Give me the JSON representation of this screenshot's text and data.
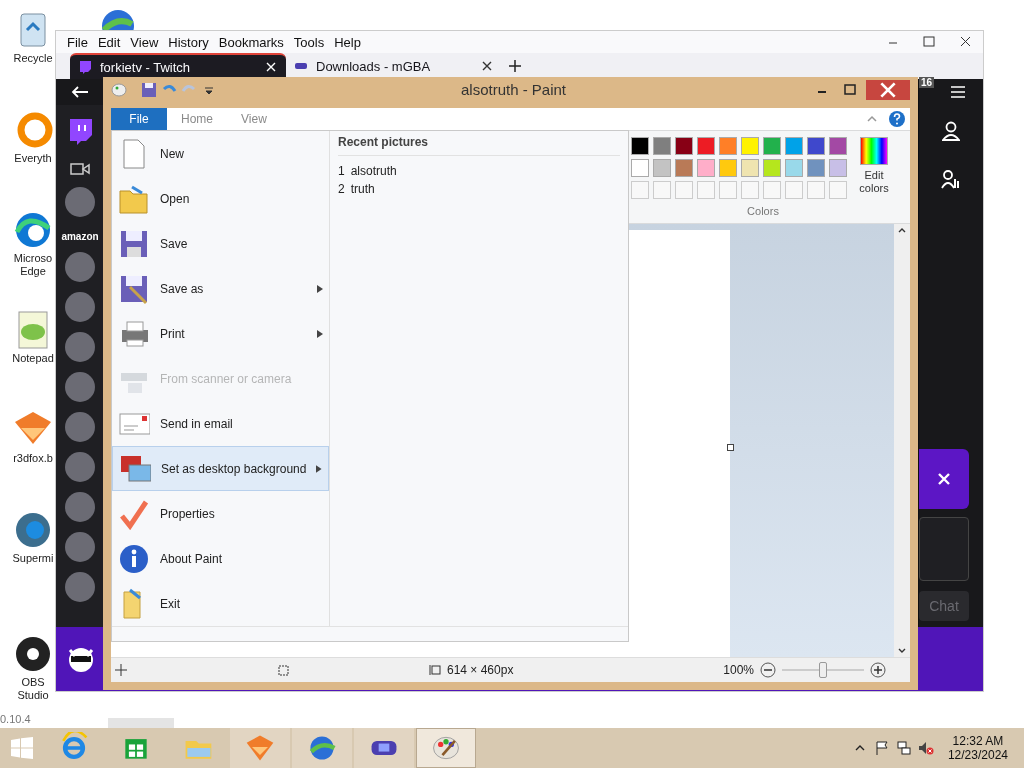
{
  "desktop": {
    "icons": [
      {
        "label": "Recycle"
      },
      {
        "label": "Everyth"
      },
      {
        "label": "Microso Edge"
      },
      {
        "label": "Notepad"
      },
      {
        "label": "r3dfox.b"
      },
      {
        "label": "Supermi"
      },
      {
        "label": "OBS Studio"
      }
    ],
    "version_text": "0.10.4"
  },
  "browser": {
    "menu": [
      "File",
      "Edit",
      "View",
      "History",
      "Bookmarks",
      "Tools",
      "Help"
    ],
    "tabs": [
      {
        "title": "forkietv - Twitch",
        "selected": true
      },
      {
        "title": "Downloads - mGBA",
        "selected": false
      }
    ],
    "twitch": {
      "notification_count": "16",
      "sidebar_text": "amazon",
      "chat_button": "Chat"
    }
  },
  "paint": {
    "title": "alsotruth - Paint",
    "ribbon_tabs": [
      {
        "label": "File",
        "selected": true
      },
      {
        "label": "Home",
        "selected": false
      },
      {
        "label": "View",
        "selected": false
      }
    ],
    "file_menu": {
      "items": [
        {
          "label": "New",
          "submenu": false,
          "disabled": false,
          "selected": false
        },
        {
          "label": "Open",
          "submenu": false,
          "disabled": false,
          "selected": false
        },
        {
          "label": "Save",
          "submenu": false,
          "disabled": false,
          "selected": false
        },
        {
          "label": "Save as",
          "submenu": true,
          "disabled": false,
          "selected": false
        },
        {
          "label": "Print",
          "submenu": true,
          "disabled": false,
          "selected": false
        },
        {
          "label": "From scanner or camera",
          "submenu": false,
          "disabled": true,
          "selected": false
        },
        {
          "label": "Send in email",
          "submenu": false,
          "disabled": false,
          "selected": false
        },
        {
          "label": "Set as desktop background",
          "submenu": true,
          "disabled": false,
          "selected": true
        },
        {
          "label": "Properties",
          "submenu": false,
          "disabled": false,
          "selected": false
        },
        {
          "label": "About Paint",
          "submenu": false,
          "disabled": false,
          "selected": false
        },
        {
          "label": "Exit",
          "submenu": false,
          "disabled": false,
          "selected": false
        }
      ],
      "recent_title": "Recent pictures",
      "recent": [
        {
          "number": "1",
          "name": "alsotruth"
        },
        {
          "number": "2",
          "name": "truth"
        }
      ]
    },
    "colors": {
      "swatches": [
        {
          "color": "#000000"
        },
        {
          "color": "#7f7f7f"
        },
        {
          "color": "#880015"
        },
        {
          "color": "#ed1c24"
        },
        {
          "color": "#ff7f27"
        },
        {
          "color": "#fff200"
        },
        {
          "color": "#22b14c"
        },
        {
          "color": "#00a2e8"
        },
        {
          "color": "#3f48cc"
        },
        {
          "color": "#a349a4"
        },
        {
          "color": "#ffffff"
        },
        {
          "color": "#c3c3c3"
        },
        {
          "color": "#b97a57"
        },
        {
          "color": "#ffaec9"
        },
        {
          "color": "#ffc90e"
        },
        {
          "color": "#efe4b0"
        },
        {
          "color": "#b5e61d"
        },
        {
          "color": "#99d9ea"
        },
        {
          "color": "#7092be"
        },
        {
          "color": "#c8bfe7"
        }
      ],
      "edit_label": "Edit colors",
      "group_label": "Colors"
    },
    "status": {
      "size": "614 × 460px",
      "zoom": "100%",
      "level": 0.5
    }
  },
  "taskbar": {
    "apps": [
      {
        "open": false,
        "selected": false
      },
      {
        "open": false,
        "selected": false
      },
      {
        "open": false,
        "selected": false
      },
      {
        "open": true,
        "selected": false
      },
      {
        "open": true,
        "selected": false
      },
      {
        "open": true,
        "selected": false
      },
      {
        "open": true,
        "selected": true
      }
    ],
    "time": "12:32 AM",
    "date": "12/23/2024"
  }
}
